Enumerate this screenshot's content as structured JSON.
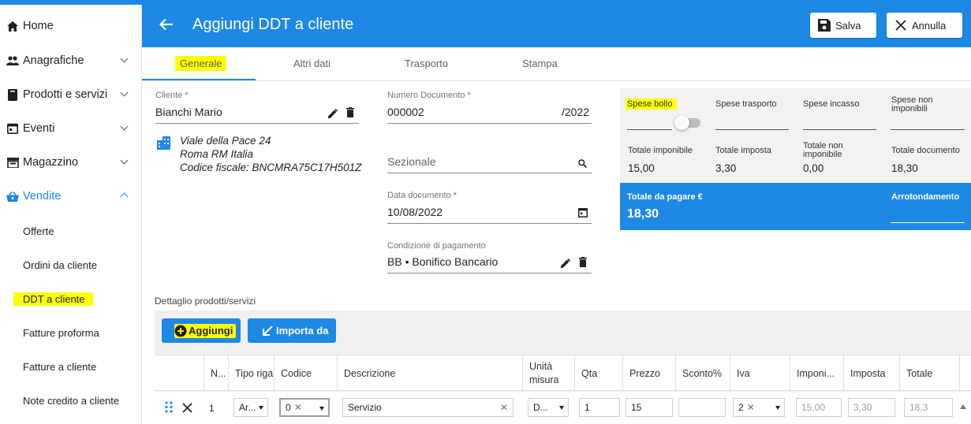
{
  "sidebar": {
    "items": [
      {
        "label": "Home"
      },
      {
        "label": "Anagrafiche"
      },
      {
        "label": "Prodotti e servizi"
      },
      {
        "label": "Eventi"
      },
      {
        "label": "Magazzino"
      },
      {
        "label": "Vendite"
      }
    ],
    "subitems": [
      {
        "label": "Offerte"
      },
      {
        "label": "Ordini da cliente"
      },
      {
        "label": "DDT a cliente"
      },
      {
        "label": "Fatture proforma"
      },
      {
        "label": "Fatture a cliente"
      },
      {
        "label": "Note credito a cliente"
      }
    ]
  },
  "header": {
    "title": "Aggiungi DDT a cliente",
    "save_label": "Salva",
    "cancel_label": "Annulla"
  },
  "tabs": [
    {
      "label": "Generale"
    },
    {
      "label": "Altri dati"
    },
    {
      "label": "Trasporto"
    },
    {
      "label": "Stampa"
    }
  ],
  "form": {
    "cliente_label": "Cliente *",
    "cliente_value": "Bianchi Mario",
    "address_line1": "Viale della Pace 24",
    "address_line2": "Roma RM Italia",
    "address_line3": "Codice fiscale: BNCMRA75C17H501Z",
    "numero_label": "Numero Documento *",
    "numero_value": "000002",
    "numero_suffix": "/2022",
    "sezionale_placeholder": "Sezionale",
    "data_label": "Data documento *",
    "data_value": "10/08/2022",
    "condizione_label": "Condizione di pagamento",
    "condizione_value": "BB • Bonifico Bancario"
  },
  "summary": {
    "spese_bollo": "Spese bollo",
    "spese_trasporto": "Spese trasporto",
    "spese_incasso": "Spese incasso",
    "spese_non_imponibili_1": "Spese non",
    "spese_non_imponibili_2": "imponibili",
    "totale_imponibile_label": "Totale imponibile",
    "totale_imponibile_value": "15,00",
    "totale_imposta_label": "Totale imposta",
    "totale_imposta_value": "3,30",
    "totale_non_imponibile_1": "Totale non",
    "totale_non_imponibile_2": "imponibile",
    "totale_non_imponibile_value": "0,00",
    "totale_documento_label": "Totale documento",
    "totale_documento_value": "18,30",
    "totale_pagare_label": "Totale da pagare €",
    "totale_pagare_value": "18,30",
    "arrotondamento_label": "Arrotondamento"
  },
  "detail": {
    "title": "Dettaglio prodotti/servizi",
    "add_label": "Aggiungi",
    "import_label": "Importa da",
    "columns": [
      "N...",
      "Tipo riga",
      "Codice",
      "Descrizione",
      "Unità misura",
      "Qta",
      "Prezzo",
      "Sconto%",
      "Iva",
      "Imponi...",
      "Imposta",
      "Totale"
    ],
    "row": {
      "n": "1",
      "tipo": "Ar...",
      "codice": "0",
      "descrizione": "Servizio",
      "unita": "D...",
      "qta": "1",
      "prezzo": "15",
      "sconto": "",
      "iva": "2",
      "imponibile": "15,00",
      "imposta": "3,30",
      "totale": "18,3"
    }
  },
  "colors": {
    "primary": "#1e88e5",
    "highlight": "#ffff00"
  }
}
